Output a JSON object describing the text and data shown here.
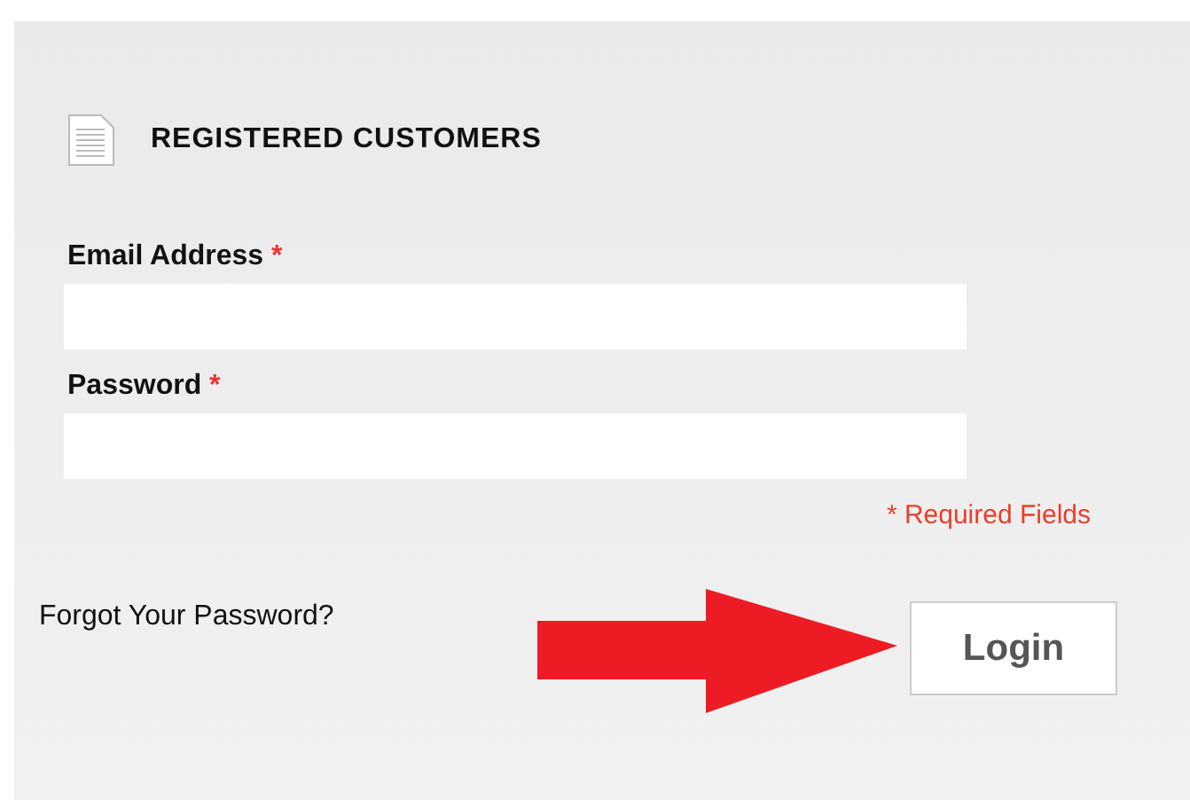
{
  "section": {
    "title": "REGISTERED CUSTOMERS"
  },
  "fields": [
    {
      "label": "Email Address",
      "required_mark": "*"
    },
    {
      "label": "Password",
      "required_mark": "*"
    }
  ],
  "required_note": "* Required Fields",
  "forgot_link": "Forgot Your Password?",
  "login_button": "Login"
}
